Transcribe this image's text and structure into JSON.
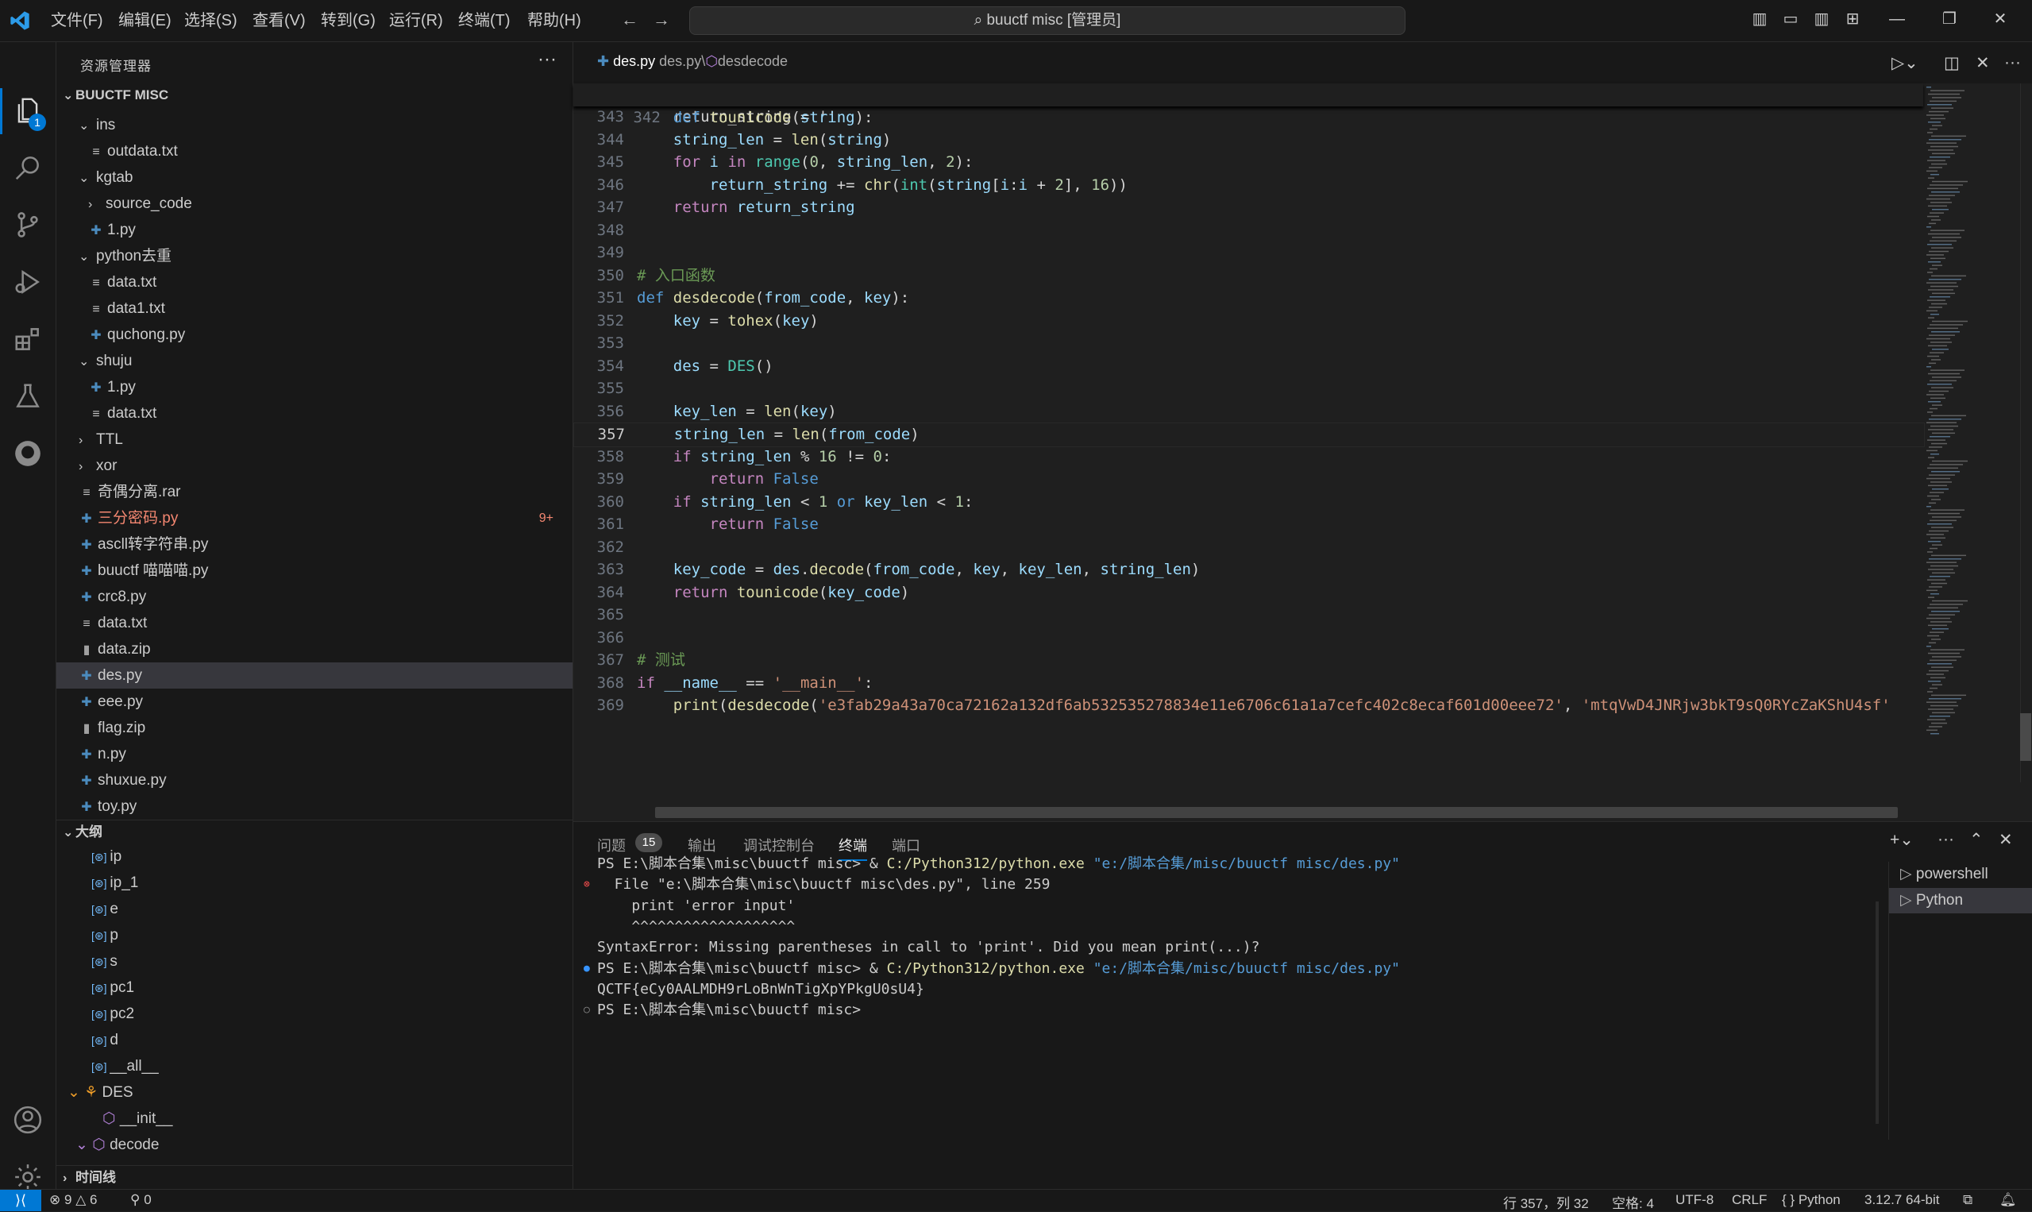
{
  "titlebar": {
    "menus": [
      "文件(F)",
      "编辑(E)",
      "选择(S)",
      "查看(V)",
      "转到(G)",
      "运行(R)",
      "终端(T)",
      "帮助(H)"
    ],
    "command_center": "buuctf misc [管理员]"
  },
  "activity": {
    "explorer_badge": "1"
  },
  "sidebar": {
    "title": "资源管理器",
    "root": "BUUCTF MISC",
    "tree": [
      {
        "label": "ins",
        "kind": "folder-open",
        "depth": 1
      },
      {
        "label": "outdata.txt",
        "kind": "txt",
        "depth": 2
      },
      {
        "label": "kgtab",
        "kind": "folder-open",
        "depth": 1
      },
      {
        "label": "source_code",
        "kind": "folder",
        "depth": 2
      },
      {
        "label": "1.py",
        "kind": "py",
        "depth": 2
      },
      {
        "label": "python去重",
        "kind": "folder-open",
        "depth": 1
      },
      {
        "label": "data.txt",
        "kind": "txt",
        "depth": 2
      },
      {
        "label": "data1.txt",
        "kind": "txt",
        "depth": 2
      },
      {
        "label": "quchong.py",
        "kind": "py",
        "depth": 2
      },
      {
        "label": "shuju",
        "kind": "folder-open",
        "depth": 1
      },
      {
        "label": "1.py",
        "kind": "py",
        "depth": 2
      },
      {
        "label": "data.txt",
        "kind": "txt",
        "depth": 2
      },
      {
        "label": "TTL",
        "kind": "folder",
        "depth": 1
      },
      {
        "label": "xor",
        "kind": "folder",
        "depth": 1
      },
      {
        "label": "奇偶分离.rar",
        "kind": "txt",
        "depth": 1
      },
      {
        "label": "三分密码.py",
        "kind": "py-err",
        "depth": 1,
        "badge": "9+"
      },
      {
        "label": "ascll转字符串.py",
        "kind": "py",
        "depth": 1
      },
      {
        "label": "buuctf 喵喵喵.py",
        "kind": "py",
        "depth": 1
      },
      {
        "label": "crc8.py",
        "kind": "py",
        "depth": 1
      },
      {
        "label": "data.txt",
        "kind": "txt",
        "depth": 1
      },
      {
        "label": "data.zip",
        "kind": "zip",
        "depth": 1
      },
      {
        "label": "des.py",
        "kind": "py",
        "depth": 1,
        "selected": true
      },
      {
        "label": "eee.py",
        "kind": "py",
        "depth": 1
      },
      {
        "label": "flag.zip",
        "kind": "zip",
        "depth": 1
      },
      {
        "label": "n.py",
        "kind": "py",
        "depth": 1
      },
      {
        "label": "shuxue.py",
        "kind": "py",
        "depth": 1
      },
      {
        "label": "toy.py",
        "kind": "py",
        "depth": 1
      }
    ],
    "outline_title": "大纲",
    "outline": [
      {
        "label": "ip",
        "kind": "var",
        "depth": 1
      },
      {
        "label": "ip_1",
        "kind": "var",
        "depth": 1
      },
      {
        "label": "e",
        "kind": "var",
        "depth": 1
      },
      {
        "label": "p",
        "kind": "var",
        "depth": 1
      },
      {
        "label": "s",
        "kind": "var",
        "depth": 1
      },
      {
        "label": "pc1",
        "kind": "var",
        "depth": 1
      },
      {
        "label": "pc2",
        "kind": "var",
        "depth": 1
      },
      {
        "label": "d",
        "kind": "var",
        "depth": 1
      },
      {
        "label": "__all__",
        "kind": "var",
        "depth": 1
      },
      {
        "label": "DES",
        "kind": "class",
        "depth": 0
      },
      {
        "label": "__init__",
        "kind": "method",
        "depth": 2
      },
      {
        "label": "decode",
        "kind": "method-open",
        "depth": 1
      }
    ],
    "timeline_title": "时间线"
  },
  "editor": {
    "tab_label": "des.py",
    "breadcrumb_file": "des.py",
    "breadcrumb_sep": "des.py\\",
    "breadcrumb_symbol": "desdecode",
    "sticky": {
      "num": "342",
      "html": "def tounicode(string):"
    },
    "lines": [
      {
        "n": "343",
        "t": [
          [
            "    return_string = ''",
            "pl"
          ]
        ]
      },
      {
        "n": "344",
        "t": [
          [
            "    ",
            "pl"
          ],
          [
            "string_len",
            "var"
          ],
          [
            " = ",
            "pl"
          ],
          [
            "len",
            "fn"
          ],
          [
            "(",
            "pl"
          ],
          [
            "string",
            "var"
          ],
          [
            ")",
            "pl"
          ]
        ]
      },
      {
        "n": "345",
        "t": [
          [
            "    ",
            "pl"
          ],
          [
            "for",
            "kw2"
          ],
          [
            " ",
            "pl"
          ],
          [
            "i",
            "var"
          ],
          [
            " ",
            "pl"
          ],
          [
            "in",
            "kw2"
          ],
          [
            " ",
            "pl"
          ],
          [
            "range",
            "cl"
          ],
          [
            "(",
            "pl"
          ],
          [
            "0",
            "num"
          ],
          [
            ", ",
            "pl"
          ],
          [
            "string_len",
            "var"
          ],
          [
            ", ",
            "pl"
          ],
          [
            "2",
            "num"
          ],
          [
            "):",
            "pl"
          ]
        ]
      },
      {
        "n": "346",
        "t": [
          [
            "        ",
            "pl"
          ],
          [
            "return_string",
            "var"
          ],
          [
            " += ",
            "pl"
          ],
          [
            "chr",
            "fn"
          ],
          [
            "(",
            "pl"
          ],
          [
            "int",
            "cl"
          ],
          [
            "(",
            "pl"
          ],
          [
            "string",
            "var"
          ],
          [
            "[",
            "pl"
          ],
          [
            "i",
            "var"
          ],
          [
            ":",
            "pl"
          ],
          [
            "i",
            "var"
          ],
          [
            " + ",
            "pl"
          ],
          [
            "2",
            "num"
          ],
          [
            "], ",
            "pl"
          ],
          [
            "16",
            "num"
          ],
          [
            "))",
            "pl"
          ]
        ]
      },
      {
        "n": "347",
        "t": [
          [
            "    ",
            "pl"
          ],
          [
            "return",
            "kw2"
          ],
          [
            " ",
            "pl"
          ],
          [
            "return_string",
            "var"
          ]
        ]
      },
      {
        "n": "348",
        "t": []
      },
      {
        "n": "349",
        "t": []
      },
      {
        "n": "350",
        "t": [
          [
            "# 入口函数",
            "com"
          ]
        ]
      },
      {
        "n": "351",
        "t": [
          [
            "def",
            "kw"
          ],
          [
            " ",
            "pl"
          ],
          [
            "desdecode",
            "fn"
          ],
          [
            "(",
            "pl"
          ],
          [
            "from_code",
            "var"
          ],
          [
            ", ",
            "pl"
          ],
          [
            "key",
            "var"
          ],
          [
            "):",
            "pl"
          ]
        ]
      },
      {
        "n": "352",
        "t": [
          [
            "    ",
            "pl"
          ],
          [
            "key",
            "var"
          ],
          [
            " = ",
            "pl"
          ],
          [
            "tohex",
            "fn"
          ],
          [
            "(",
            "pl"
          ],
          [
            "key",
            "var"
          ],
          [
            ")",
            "pl"
          ]
        ]
      },
      {
        "n": "353",
        "t": []
      },
      {
        "n": "354",
        "t": [
          [
            "    ",
            "pl"
          ],
          [
            "des",
            "var"
          ],
          [
            " = ",
            "pl"
          ],
          [
            "DES",
            "cl"
          ],
          [
            "()",
            "pl"
          ]
        ]
      },
      {
        "n": "355",
        "t": []
      },
      {
        "n": "356",
        "t": [
          [
            "    ",
            "pl"
          ],
          [
            "key_len",
            "var"
          ],
          [
            " = ",
            "pl"
          ],
          [
            "len",
            "fn"
          ],
          [
            "(",
            "pl"
          ],
          [
            "key",
            "var"
          ],
          [
            ")",
            "pl"
          ]
        ]
      },
      {
        "n": "357",
        "t": [
          [
            "    ",
            "pl"
          ],
          [
            "string_len",
            "var"
          ],
          [
            " = ",
            "pl"
          ],
          [
            "len",
            "fn"
          ],
          [
            "(",
            "pl"
          ],
          [
            "from_code",
            "var"
          ],
          [
            ")",
            "pl"
          ]
        ],
        "current": true
      },
      {
        "n": "358",
        "t": [
          [
            "    ",
            "pl"
          ],
          [
            "if",
            "kw2"
          ],
          [
            " ",
            "pl"
          ],
          [
            "string_len",
            "var"
          ],
          [
            " % ",
            "pl"
          ],
          [
            "16",
            "num"
          ],
          [
            " != ",
            "pl"
          ],
          [
            "0",
            "num"
          ],
          [
            ":",
            "pl"
          ]
        ]
      },
      {
        "n": "359",
        "t": [
          [
            "        ",
            "pl"
          ],
          [
            "return",
            "kw2"
          ],
          [
            " ",
            "pl"
          ],
          [
            "False",
            "kw"
          ]
        ]
      },
      {
        "n": "360",
        "t": [
          [
            "    ",
            "pl"
          ],
          [
            "if",
            "kw2"
          ],
          [
            " ",
            "pl"
          ],
          [
            "string_len",
            "var"
          ],
          [
            " < ",
            "pl"
          ],
          [
            "1",
            "num"
          ],
          [
            " ",
            "pl"
          ],
          [
            "or",
            "kw"
          ],
          [
            " ",
            "pl"
          ],
          [
            "key_len",
            "var"
          ],
          [
            " < ",
            "pl"
          ],
          [
            "1",
            "num"
          ],
          [
            ":",
            "pl"
          ]
        ]
      },
      {
        "n": "361",
        "t": [
          [
            "        ",
            "pl"
          ],
          [
            "return",
            "kw2"
          ],
          [
            " ",
            "pl"
          ],
          [
            "False",
            "kw"
          ]
        ]
      },
      {
        "n": "362",
        "t": []
      },
      {
        "n": "363",
        "t": [
          [
            "    ",
            "pl"
          ],
          [
            "key_code",
            "var"
          ],
          [
            " = ",
            "pl"
          ],
          [
            "des",
            "var"
          ],
          [
            ".",
            "pl"
          ],
          [
            "decode",
            "fn"
          ],
          [
            "(",
            "pl"
          ],
          [
            "from_code",
            "var"
          ],
          [
            ", ",
            "pl"
          ],
          [
            "key",
            "var"
          ],
          [
            ", ",
            "pl"
          ],
          [
            "key_len",
            "var"
          ],
          [
            ", ",
            "pl"
          ],
          [
            "string_len",
            "var"
          ],
          [
            ")",
            "pl"
          ]
        ]
      },
      {
        "n": "364",
        "t": [
          [
            "    ",
            "pl"
          ],
          [
            "return",
            "kw2"
          ],
          [
            " ",
            "pl"
          ],
          [
            "tounicode",
            "fn"
          ],
          [
            "(",
            "pl"
          ],
          [
            "key_code",
            "var"
          ],
          [
            ")",
            "pl"
          ]
        ]
      },
      {
        "n": "365",
        "t": []
      },
      {
        "n": "366",
        "t": []
      },
      {
        "n": "367",
        "t": [
          [
            "# 测试",
            "com"
          ]
        ]
      },
      {
        "n": "368",
        "t": [
          [
            "if",
            "kw2"
          ],
          [
            " ",
            "pl"
          ],
          [
            "__name__",
            "var"
          ],
          [
            " == ",
            "pl"
          ],
          [
            "'__main__'",
            "str"
          ],
          [
            ":",
            "pl"
          ]
        ]
      },
      {
        "n": "369",
        "t": [
          [
            "    ",
            "pl"
          ],
          [
            "print",
            "fn"
          ],
          [
            "(",
            "pl"
          ],
          [
            "desdecode",
            "fn"
          ],
          [
            "(",
            "pl"
          ],
          [
            "'e3fab29a43a70ca72162a132df6ab532535278834e11e6706c61a1a7cefc402c8ecaf601d00eee72'",
            "str"
          ],
          [
            ", ",
            "pl"
          ],
          [
            "'mtqVwD4JNRjw3bkT9sQ0RYcZaKShU4sf'",
            "str"
          ]
        ]
      }
    ]
  },
  "panel": {
    "tabs": [
      "问题",
      "输出",
      "调试控制台",
      "终端",
      "端口"
    ],
    "problems_count": "15",
    "active_tab": "终端",
    "terminal": [
      {
        "dot": "",
        "parts": [
          [
            "PS E:\\脚本合集\\misc\\buuctf misc> & ",
            "tpath"
          ],
          [
            "C:/Python312/python.exe",
            "texe"
          ],
          [
            " \"e:/脚本合集/misc/buuctf misc/des.py\"",
            "tstr"
          ]
        ]
      },
      {
        "dot": "err",
        "parts": [
          [
            "  File \"e:\\脚本合集\\misc\\buuctf misc\\des.py\", line 259",
            "tpath"
          ]
        ]
      },
      {
        "dot": "",
        "parts": [
          [
            "    print 'error input'",
            "tpath"
          ]
        ]
      },
      {
        "dot": "",
        "parts": [
          [
            "    ^^^^^^^^^^^^^^^^^^^",
            "tpath"
          ]
        ]
      },
      {
        "dot": "",
        "parts": [
          [
            "SyntaxError: Missing parentheses in call to 'print'. Did you mean print(...)?",
            "tpath"
          ]
        ]
      },
      {
        "dot": "ok",
        "parts": [
          [
            "PS E:\\脚本合集\\misc\\buuctf misc> & ",
            "tpath"
          ],
          [
            "C:/Python312/python.exe",
            "texe"
          ],
          [
            " \"e:/脚本合集/misc/buuctf misc/des.py\"",
            "tstr"
          ]
        ]
      },
      {
        "dot": "",
        "parts": [
          [
            "QCTF{eCy0AALMDH9rLoBnWnTigXpYPkgU0sU4}",
            "tpath"
          ]
        ]
      },
      {
        "dot": "idle",
        "parts": [
          [
            "PS E:\\脚本合集\\misc\\buuctf misc> ",
            "tpath"
          ]
        ]
      }
    ],
    "terminal_list": [
      "powershell",
      "Python"
    ]
  },
  "status": {
    "errors": "9",
    "warnings": "6",
    "ports": "0",
    "position": "行 357，列 32",
    "spaces": "空格: 4",
    "encoding": "UTF-8",
    "eol": "CRLF",
    "language": "Python",
    "interpreter": "3.12.7 64-bit"
  }
}
